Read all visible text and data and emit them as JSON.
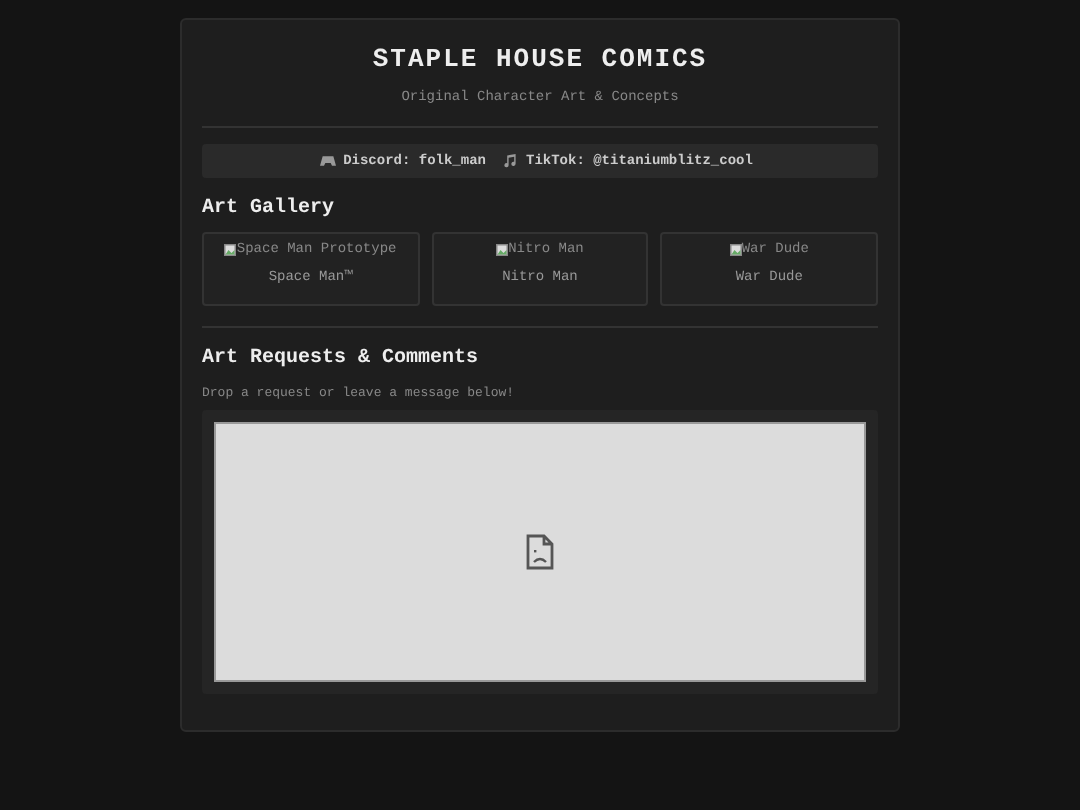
{
  "header": {
    "title": "STAPLE HOUSE COMICS",
    "subtitle": "Original Character Art & Concepts"
  },
  "socials": [
    {
      "kind": "gamepad",
      "label": "Discord:",
      "value": "folk_man"
    },
    {
      "kind": "music",
      "label": "TikTok:",
      "value": "@titaniumblitz_cool"
    }
  ],
  "gallery": {
    "heading": "Art Gallery",
    "items": [
      {
        "alt": "Space Man Prototype",
        "caption": "Space Man™"
      },
      {
        "alt": "Nitro Man",
        "caption": "Nitro Man"
      },
      {
        "alt": "War Dude",
        "caption": "War Dude"
      }
    ]
  },
  "requests": {
    "heading": "Art Requests & Comments",
    "text": "Drop a request or leave a message below!"
  }
}
